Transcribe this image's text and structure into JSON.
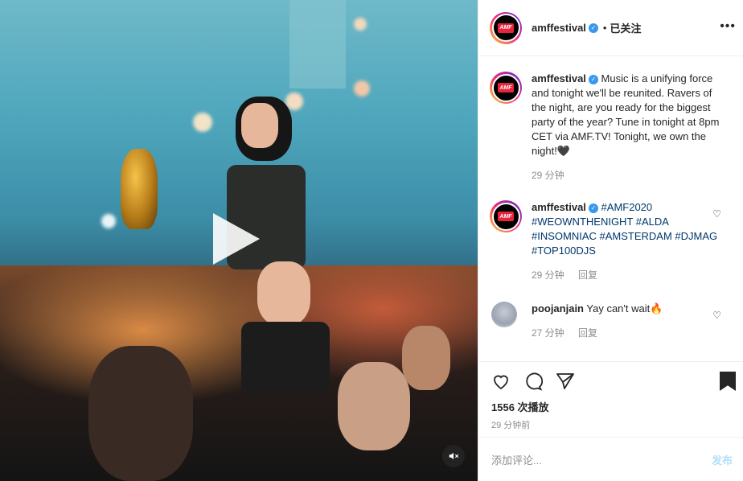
{
  "post": {
    "author": "amffestival",
    "follow_separator": "•",
    "follow_label": "已关注",
    "more_icon": "more-horizontal-icon",
    "avatar_logo_text": "AMF"
  },
  "comments": [
    {
      "author": "amffestival",
      "text": "Music is a unifying force and tonight we'll be reunited. Ravers of the night, are you ready for the biggest party of the year? Tune in tonight at 8pm CET via AMF.TV! Tonight, we own the night!🖤",
      "time": "29 分钟"
    },
    {
      "author": "amffestival",
      "text": "#AMF2020 #WEOWNTHENIGHT #ALDA #INSOMNIAC #AMSTERDAM #DJMAG #TOP100DJS",
      "time": "29 分钟",
      "reply": "回复"
    },
    {
      "author": "poojanjain",
      "text": "Yay can't wait🔥",
      "time": "27 分钟",
      "reply": "回复"
    }
  ],
  "stats": {
    "views": "1556 次播放",
    "posted_ago": "29 分钟前"
  },
  "compose": {
    "placeholder": "添加评论...",
    "post_label": "发布"
  },
  "colors": {
    "link": "#00376b",
    "verified": "#3897f0",
    "muted": "#8e8e8e",
    "post_disabled": "#b2dffc"
  }
}
